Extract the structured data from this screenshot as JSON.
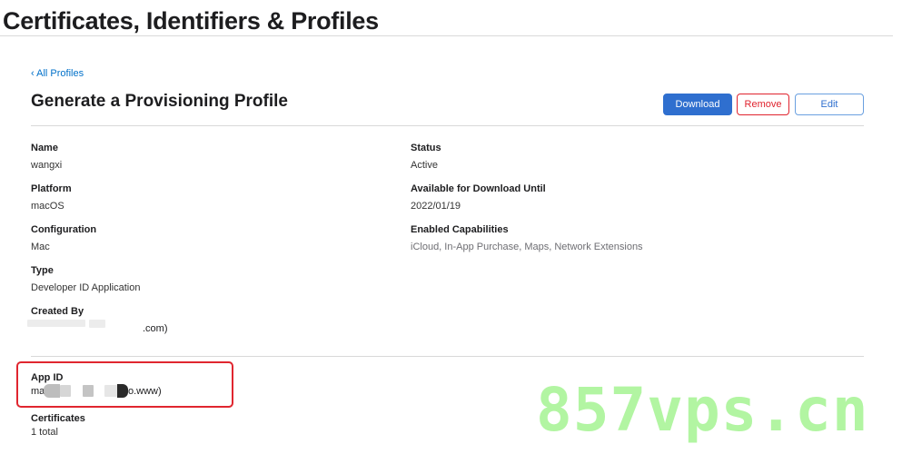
{
  "header": {
    "title": "Certificates, Identifiers & Profiles"
  },
  "nav": {
    "back_label": "‹ All Profiles"
  },
  "profile": {
    "heading": "Generate a Provisioning Profile",
    "actions": {
      "download": "Download",
      "remove": "Remove",
      "edit": "Edit"
    },
    "left_fields": [
      {
        "label": "Name",
        "value": "wangxi"
      },
      {
        "label": "Platform",
        "value": "macOS"
      },
      {
        "label": "Configuration",
        "value": "Mac"
      },
      {
        "label": "Type",
        "value": "Developer ID Application"
      },
      {
        "label": "Created By",
        "value": ".com)"
      }
    ],
    "right_fields": [
      {
        "label": "Status",
        "value": "Active"
      },
      {
        "label": "Available for Download Until",
        "value": "2022/01/19"
      },
      {
        "label": "Enabled Capabilities",
        "value": "iCloud, In-App Purchase, Maps, Network Extensions"
      }
    ],
    "app_id": {
      "label": "App ID",
      "value_prefix": "ma",
      "value_suffix": "o.www)"
    },
    "certificates": {
      "label": "Certificates",
      "value": "1 total"
    }
  },
  "watermark": {
    "text": "857vps.cn"
  },
  "colors": {
    "primary": "#2f6fcf",
    "danger": "#e0232e",
    "link": "#0070c9",
    "watermark": "#b2f5a2"
  }
}
